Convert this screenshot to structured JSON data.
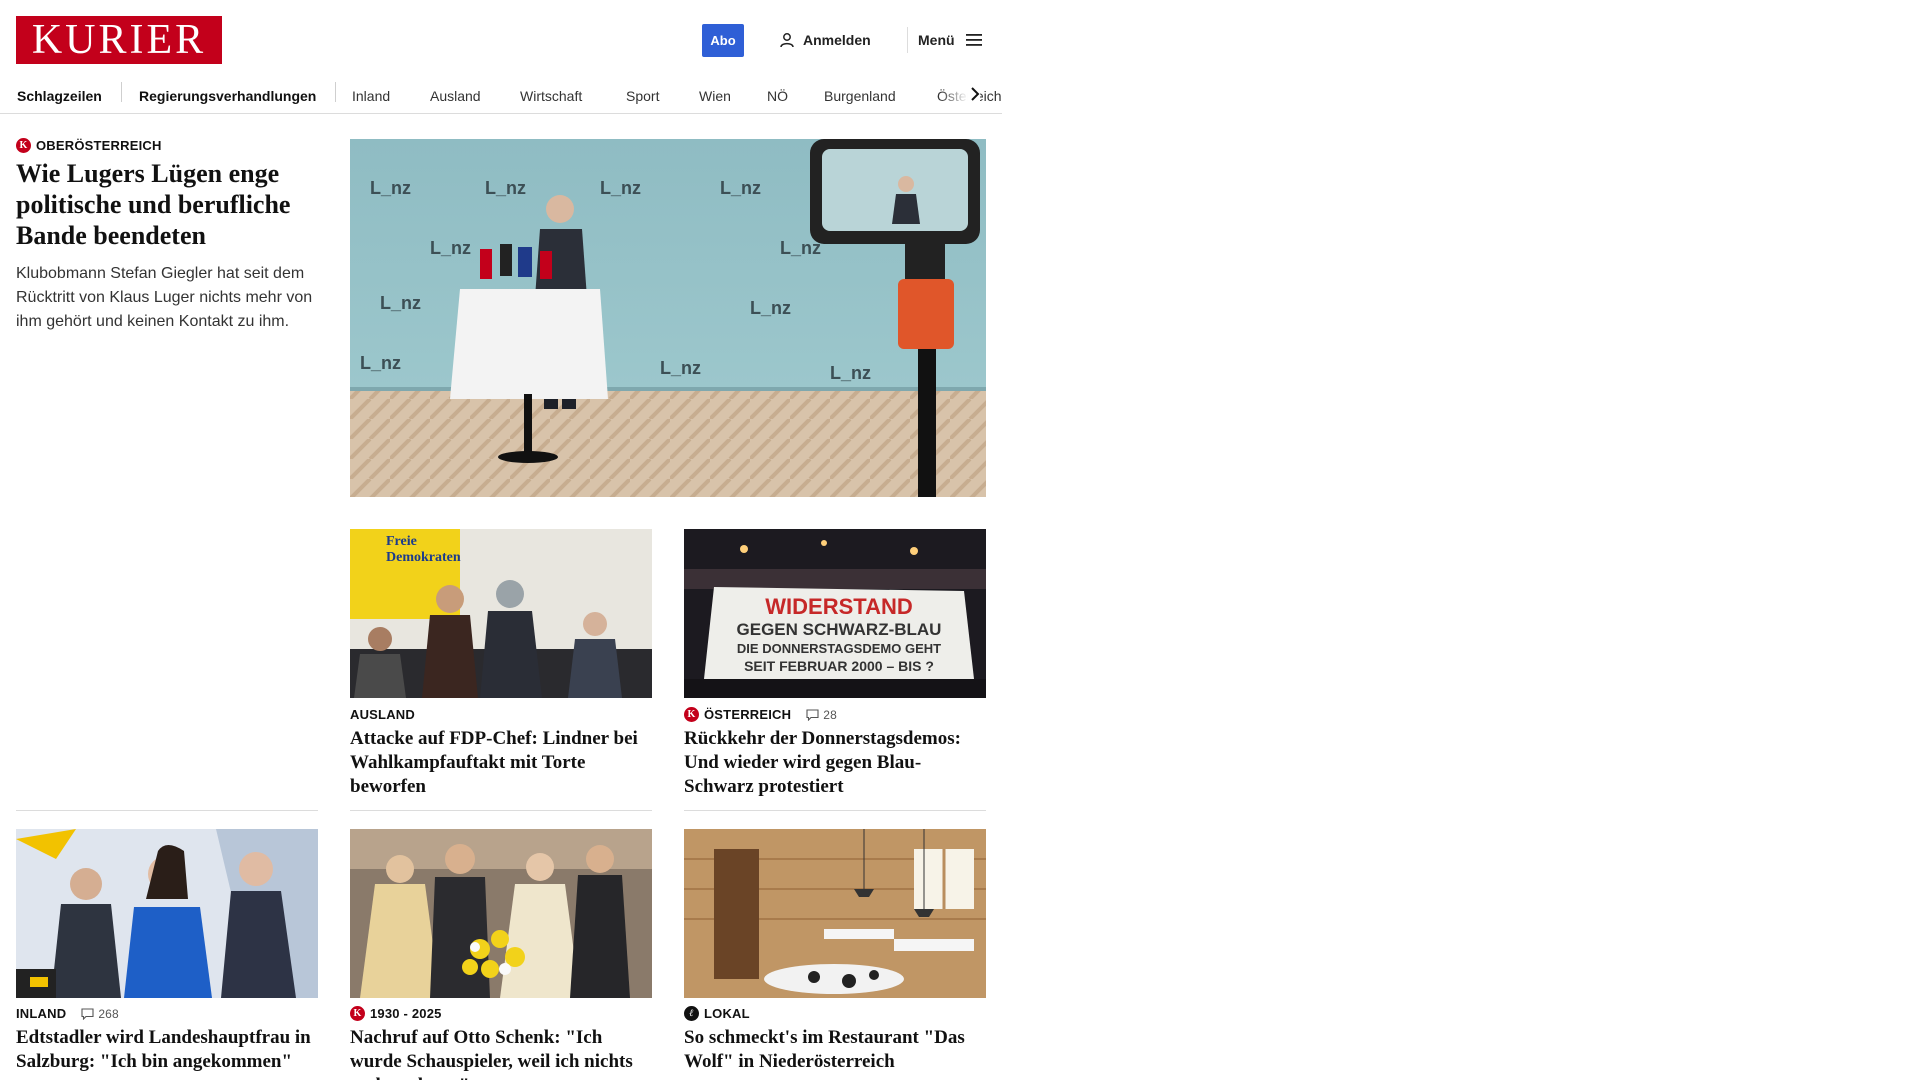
{
  "header": {
    "logo_text": "KURIER",
    "abo_label": "Abo",
    "login_label": "Anmelden",
    "menu_label": "Menü"
  },
  "nav": {
    "items": [
      "Schlagzeilen",
      "Regierungsverhandlungen",
      "Inland",
      "Ausland",
      "Wirtschaft",
      "Sport",
      "Wien",
      "NÖ",
      "Burgenland",
      "Österreich"
    ]
  },
  "lead": {
    "kicker": "OBERÖSTERREICH",
    "headline": "Wie Lugers Lügen enge politische und berufliche Bande beendeten",
    "teaser": "Klubobmann Stefan Giegler hat seit dem Rücktritt von Klaus Luger nichts mehr von ihm gehört und keinen Kontakt zu ihm."
  },
  "articles": [
    {
      "kicker": "AUSLAND",
      "comments": "",
      "headline": "Attacke auf FDP-Chef: Lindner bei Wahlkampfauftakt mit Torte beworfen",
      "image_text_1": "Freie",
      "image_text_2": "Demokraten"
    },
    {
      "kicker": "ÖSTERREICH",
      "comments": "28",
      "headline": "Rückkehr der Donnerstagsdemos: Und wieder wird gegen Blau-Schwarz protestiert",
      "banner_line1": "WIDERSTAND",
      "banner_line2": "GEGEN SCHWARZ-BLAU",
      "banner_line3": "DIE DONNERSTAGSDEMO GEHT",
      "banner_line4": "SEIT FEBRUAR 2000 – BIS ?"
    },
    {
      "kicker": "INLAND",
      "comments": "268",
      "headline": "Edtstadler wird Landeshauptfrau in Salzburg: \"Ich bin angekommen\""
    },
    {
      "kicker": "1930 - 2025",
      "comments": "",
      "headline": "Nachruf auf Otto Schenk: \"Ich wurde Schauspieler, weil ich nichts anderes kann\""
    },
    {
      "kicker": "LOKAL",
      "comments": "",
      "headline": "So schmeckt's im Restaurant \"Das Wolf\" in Niederösterreich"
    }
  ],
  "hero_image": {
    "backdrop_word": "L_nz"
  },
  "colors": {
    "brand": "#c3001b",
    "abo": "#2f5fd6"
  }
}
